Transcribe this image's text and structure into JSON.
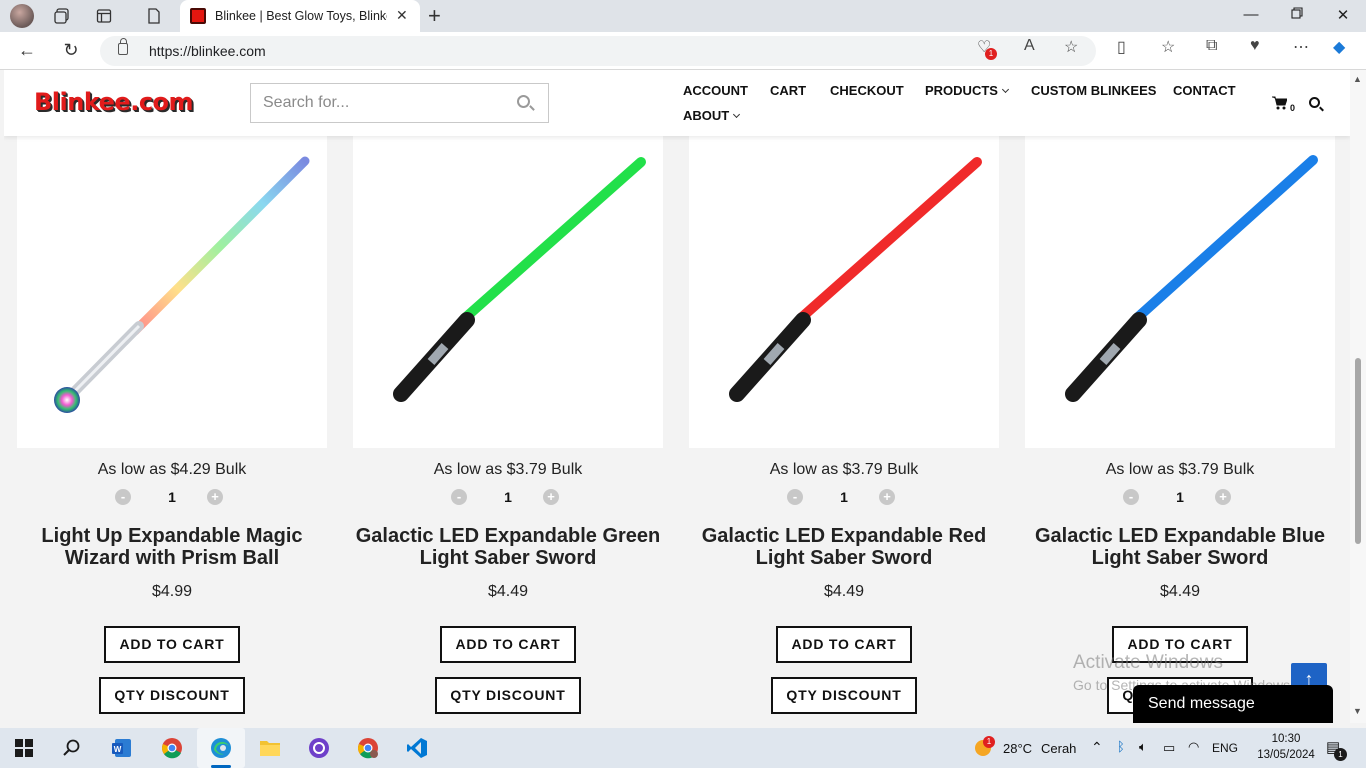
{
  "browser": {
    "tab_title": "Blinkee | Best Glow Toys, Blinkee",
    "url": "https://blinkee.com",
    "tracker_badge": "1"
  },
  "site": {
    "logo": "Blinkee.com",
    "search_placeholder": "Search for...",
    "menu": {
      "account": "ACCOUNT",
      "cart": "CART",
      "checkout": "CHECKOUT",
      "products": "PRODUCTS",
      "custom": "CUSTOM BLINKEES",
      "contact": "CONTACT",
      "about": "ABOUT"
    },
    "cart_count": "0"
  },
  "products": [
    {
      "low_price": "As low as $4.29 Bulk",
      "qty": "1",
      "name": "Light Up Expandable Magic Wizard with Prism Ball",
      "price": "$4.99",
      "add_to_cart": "ADD TO CART",
      "qty_discount": "QTY DISCOUNT",
      "blade_color": "rainbow"
    },
    {
      "low_price": "As low as $3.79 Bulk",
      "qty": "1",
      "name": "Galactic LED Expandable Green Light Saber Sword",
      "price": "$4.49",
      "add_to_cart": "ADD TO CART",
      "qty_discount": "QTY DISCOUNT",
      "blade_color": "#22e04a"
    },
    {
      "low_price": "As low as $3.79 Bulk",
      "qty": "1",
      "name": "Galactic LED Expandable Red Light Saber Sword",
      "price": "$4.49",
      "add_to_cart": "ADD TO CART",
      "qty_discount": "QTY DISCOUNT",
      "blade_color": "#f02a2a"
    },
    {
      "low_price": "As low as $3.79 Bulk",
      "qty": "1",
      "name": "Galactic LED Expandable Blue Light Saber Sword",
      "price": "$4.49",
      "add_to_cart": "ADD TO CART",
      "qty_discount": "QTY DISCOUNT",
      "blade_color": "#1a7fe8"
    }
  ],
  "overlays": {
    "activate_title": "Activate Windows",
    "activate_sub": "Go to Settings to activate Windows.",
    "send_message": "Send message"
  },
  "taskbar": {
    "weather_temp": "28°C",
    "weather_text": "Cerah",
    "weather_badge": "1",
    "language": "ENG",
    "time": "10:30",
    "date": "13/05/2024",
    "notif_count": "1"
  },
  "colors": {
    "accent_blue": "#1e63c5",
    "button_border": "#111111"
  }
}
